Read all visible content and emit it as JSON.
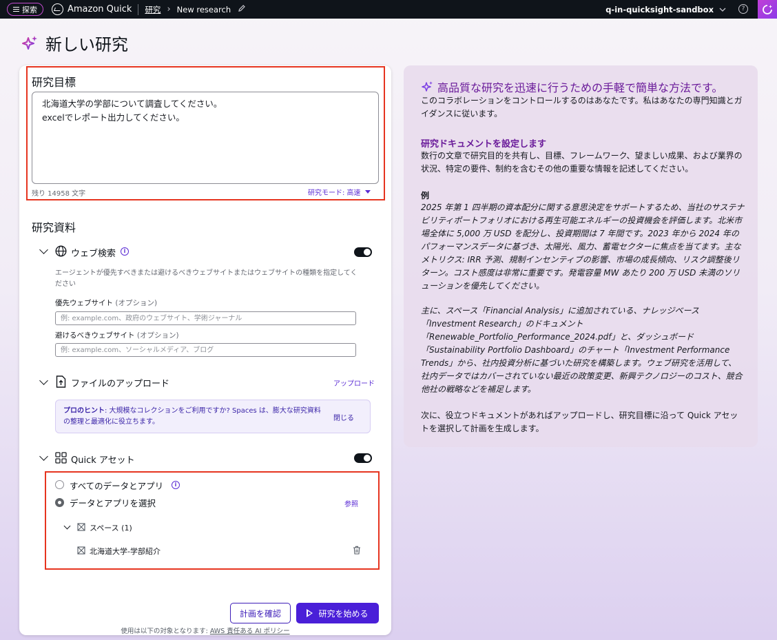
{
  "topbar": {
    "explore_label": "探索",
    "app_name": "Amazon Quick",
    "breadcrumb_research": "研究",
    "breadcrumb_current": "New research",
    "account_name": "q-in-quicksight-sandbox"
  },
  "page": {
    "title": "新しい研究"
  },
  "objective": {
    "label": "研究目標",
    "text": "北海道大学の学部について調査してください。\nexcelでレポート出力してください。",
    "remaining": "残り 14958 文字",
    "mode": "研究モード: 高速"
  },
  "materials": {
    "label": "研究資料",
    "web": {
      "title": "ウェブ検索",
      "help": "エージェントが優先すべきまたは避けるべきウェブサイトまたはウェブサイトの種類を指定してください",
      "preferred_label": "優先ウェブサイト",
      "preferred_optional": "(オプション)",
      "preferred_placeholder": "例: example.com、政府のウェブサイト、学術ジャーナル",
      "avoid_label": "避けるべきウェブサイト",
      "avoid_optional": "(オプション)",
      "avoid_placeholder": "例: example.com、ソーシャルメディア、ブログ"
    },
    "upload": {
      "title": "ファイルのアップロード",
      "action": "アップロード",
      "tip_bold": "プロのヒント",
      "tip_text": ": 大規模なコレクションをご利用ですか? Spaces は、膨大な研究資料の整理と最適化に役立ちます。",
      "tip_close": "閉じる"
    },
    "assets": {
      "title": "Quick アセット",
      "option_all": "すべてのデータとアプリ",
      "option_select": "データとアプリを選択",
      "browse": "参照",
      "spaces_label": "スペース (1)",
      "space_item": "北海道大学-学部紹介"
    }
  },
  "actions": {
    "review_plan": "計画を確認",
    "start_research": "研究を始める",
    "footnote_prefix": "使用は以下の対象となります: ",
    "footnote_link": "AWS 責任ある AI ポリシー"
  },
  "guide": {
    "heading": "高品質な研究を迅速に行うための手軽で簡単な方法です。",
    "intro": "このコラボレーションをコントロールするのはあなたです。私はあなたの専門知識とガイダンスに従います。",
    "doc_heading": "研究ドキュメントを設定します",
    "doc_text": "数行の文章で研究目的を共有し、目標、フレームワーク、望ましい成果、および業界の状況、特定の要件、制約を含むその他の重要な情報を記述してください。",
    "example_label": "例",
    "example_p1": "2025 年第 1 四半期の資本配分に関する意思決定をサポートするため、当社のサステナビリティポートフォリオにおける再生可能エネルギーの投資機会を評価します。北米市場全体に 5,000 万 USD を配分し、投資期間は 7 年間です。2023 年から 2024 年のパフォーマンスデータに基づき、太陽光、風力、蓄電セクターに焦点を当てます。主なメトリクス: IRR 予測、規制インセンティブの影響、市場の成長傾向、リスク調整後リターン。コスト感度は非常に重要です。発電容量 MW あたり 200 万 USD 未満のソリューションを優先してください。",
    "example_p2": "主に、スペース「Financial Analysis」に追加されている、ナレッジベース「Investment Research」のドキュメント「Renewable_Portfolio_Performance_2024.pdf」と、ダッシュボード「Sustainability Portfolio Dashboard」のチャート「Investment Performance Trends」から、社内投資分析に基づいた研究を構築します。ウェブ研究を活用して、社内データではカバーされていない最近の政策変更、新興テクノロジーのコスト、競合他社の戦略などを補足します。",
    "closing": "次に、役立つドキュメントがあればアップロードし、研究目標に沿って Quick アセットを選択して計画を生成します。"
  },
  "colors": {
    "accent": "#4a1fd8",
    "highlight_border": "#e6341f",
    "guide_heading": "#6a1b9a",
    "topbar_bg": "#0f141a"
  }
}
